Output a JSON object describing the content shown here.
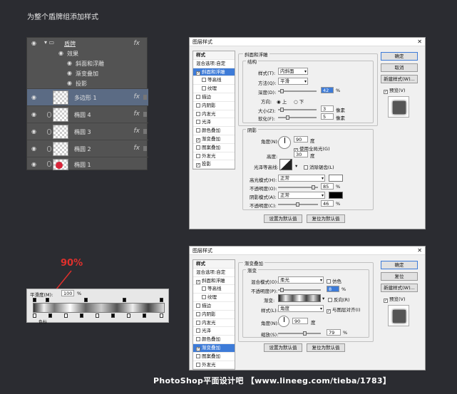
{
  "title": "为整个盾牌组添加样式",
  "layers": {
    "group": "盾牌",
    "effects": "效果",
    "e1": "斜面和浮雕",
    "e2": "渐变叠加",
    "e3": "投影",
    "rows": [
      "多边形 1",
      "椭圆 4",
      "椭圆 3",
      "椭圆 2",
      "椭圆 1"
    ],
    "fx": "fx"
  },
  "d1": {
    "title": "图层样式",
    "close": "✕",
    "side": [
      "样式",
      "混合选项:自定",
      "斜面和浮雕",
      "等高线",
      "纹理",
      "描边",
      "内阴影",
      "内发光",
      "光泽",
      "颜色叠加",
      "渐变叠加",
      "图案叠加",
      "外发光",
      "投影"
    ],
    "checks": [
      false,
      false,
      true,
      false,
      false,
      false,
      false,
      false,
      false,
      false,
      true,
      false,
      false,
      true
    ],
    "section": "斜面和浮雕",
    "struct": "结构",
    "style_l": "样式(T):",
    "style_v": "内斜面",
    "method_l": "方法(Q):",
    "method_v": "平滑",
    "depth_l": "深度(D):",
    "depth_v": "42",
    "pct": "%",
    "dir_l": "方向:",
    "up": "上",
    "down": "下",
    "size_l": "大小(Z):",
    "size_v": "3",
    "px": "像素",
    "soft_l": "软化(F):",
    "soft_v": "5",
    "shade": "阴影",
    "angle_l": "角度(N):",
    "angle_v": "90",
    "deg": "度",
    "global": "使用全局光(G)",
    "alt_l": "高度:",
    "alt_v": "30",
    "gloss_l": "光泽等高线:",
    "anti": "消除锯齿(L)",
    "hmode_l": "高光模式(H):",
    "hmode_v": "正常",
    "op1_l": "不透明度(O):",
    "op1_v": "85",
    "smode_l": "阴影模式(A):",
    "smode_v": "正常",
    "op2_l": "不透明度(C):",
    "op2_v": "46",
    "default": "设置为默认值",
    "reset": "复位为默认值",
    "ok": "确定",
    "cancel": "取消",
    "new": "新建样式(W)...",
    "preview": "预览(V)"
  },
  "d2": {
    "title": "图层样式",
    "close": "✕",
    "side": [
      "样式",
      "混合选项:自定",
      "斜面和浮雕",
      "等高线",
      "纹理",
      "描边",
      "内阴影",
      "内发光",
      "光泽",
      "颜色叠加",
      "渐变叠加",
      "图案叠加",
      "外发光"
    ],
    "checks": [
      false,
      false,
      true,
      false,
      false,
      false,
      false,
      false,
      false,
      false,
      true,
      false,
      false
    ],
    "section": "渐变叠加",
    "grad": "渐变",
    "blend_l": "混合模式(O):",
    "blend_v": "柔光",
    "dither": "仿色",
    "op_l": "不透明度(P):",
    "op_v": "8",
    "pct": "%",
    "grad_l": "渐变:",
    "reverse": "反向(R)",
    "style_l": "样式(L):",
    "style_v": "角度",
    "align": "与图层对齐(I)",
    "angle_l": "角度(N):",
    "angle_v": "90",
    "deg": "度",
    "scale_l": "缩放(S):",
    "scale_v": "79",
    "default": "设置为默认值",
    "reset": "复位为默认值",
    "ok": "确定",
    "cancel": "复位",
    "new": "新建样式(W)...",
    "preview": "预览(V)"
  },
  "gradient": {
    "annot": "90%",
    "smooth_l": "平滑度(M):",
    "smooth_v": "100",
    "pct": "%",
    "color_l": "色标"
  },
  "watermark": "PhotoShop平面设计吧 【www.lineeg.com/tieba/1783】",
  "colors": {
    "annot": "#e0302c",
    "selected": "#3d7bd8"
  }
}
